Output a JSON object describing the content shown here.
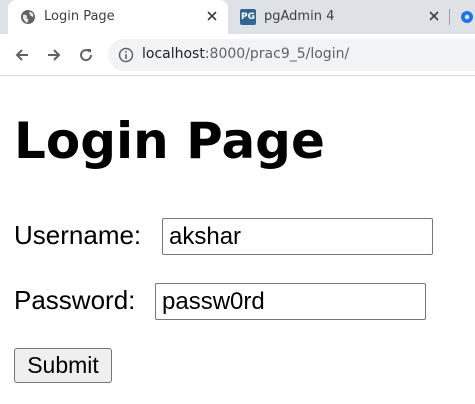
{
  "tabs": [
    {
      "title": "Login Page",
      "active": true,
      "icon": "globe-icon"
    },
    {
      "title": "pgAdmin 4",
      "active": false,
      "icon": "pgadmin-icon",
      "icon_text": "PG"
    }
  ],
  "toolbar": {
    "url_host": "localhost",
    "url_rest": ":8000/prac9_5/login/"
  },
  "page": {
    "heading": "Login Page",
    "username_label": "Username:",
    "username_value": "akshar",
    "password_label": "Password:",
    "password_value": "passw0rd",
    "submit_label": "Submit"
  },
  "colors": {
    "tabstrip_bg": "#dee1e6",
    "omnibox_bg": "#f1f3f4",
    "pgadmin_blue": "#336791",
    "extension_blue": "#1a73e8"
  }
}
